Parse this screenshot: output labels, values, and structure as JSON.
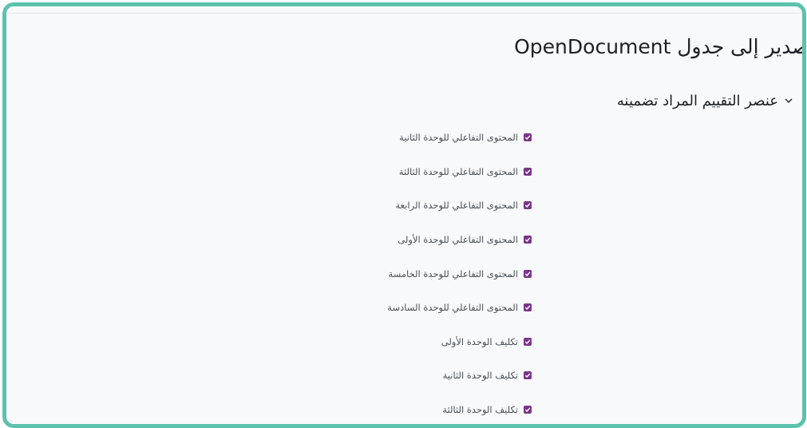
{
  "page": {
    "title": "تصدير إلى جدول OpenDocument"
  },
  "section": {
    "title": "عنصر التقييم المراد تضمينه",
    "collapse_icon": "chevron-down-icon"
  },
  "grade_items": [
    {
      "label": "المحتوى التفاعلي للوحدة الثانية",
      "checked": true
    },
    {
      "label": "المحتوى التفاعلي للوحدة الثالثة",
      "checked": true
    },
    {
      "label": "المحتوى التفاعلي للوحدة الرابعة",
      "checked": true
    },
    {
      "label": "المحتوى التفاعلي للوحدة الأولى",
      "checked": true
    },
    {
      "label": "المحتوى التفاعلي للوحدة الخامسة",
      "checked": true
    },
    {
      "label": "المحتوى التفاعلي للوحدة السادسة",
      "checked": true
    },
    {
      "label": "تكليف الوحدة الأولى",
      "checked": true
    },
    {
      "label": "تكليف الوحدة الثانية",
      "checked": true
    },
    {
      "label": "تكليف الوحدة الثالثة",
      "checked": true
    }
  ],
  "colors": {
    "frame_border": "#5cc2ae",
    "checkbox": "#7a3689",
    "background": "#f8f9fa"
  }
}
